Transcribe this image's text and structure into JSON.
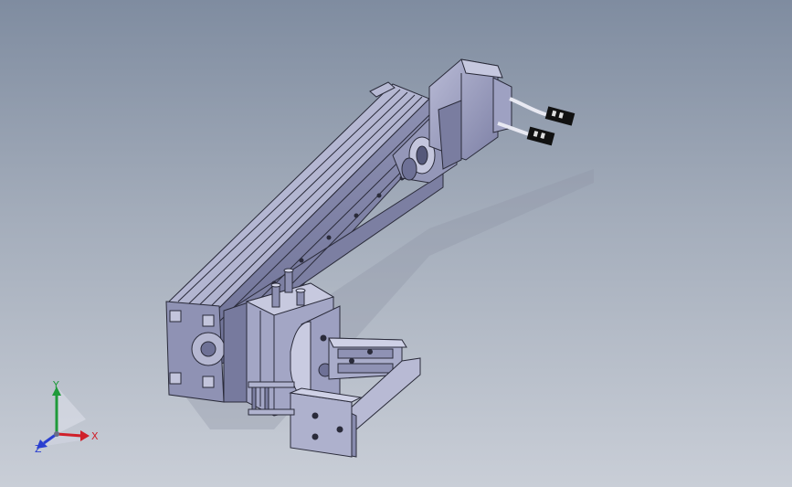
{
  "triad": {
    "x_label": "X",
    "y_label": "Y",
    "z_label": "Z",
    "x_color": "#d0202a",
    "y_color": "#1f9a3a",
    "z_color": "#2a3fd0"
  },
  "model": {
    "body_color": "#a6a9c8",
    "edge_color": "#2a2b3a",
    "motor_color": "#9ea1c2",
    "connector_color": "#111111"
  }
}
